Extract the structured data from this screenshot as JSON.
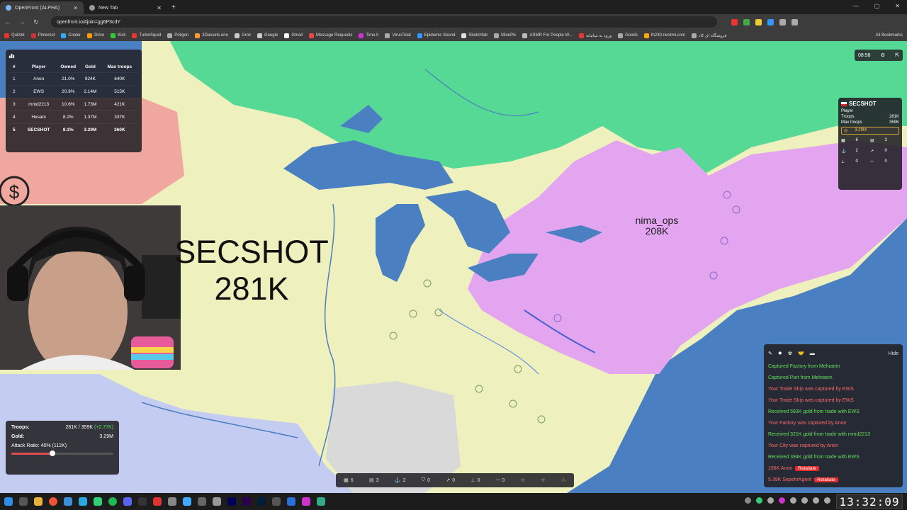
{
  "browser": {
    "tabs": [
      {
        "title": "OpenFront (ALPHA)",
        "active": true
      },
      {
        "title": "New Tab",
        "active": false
      }
    ],
    "url": "openfront.io/#join=gg6P3cdY",
    "bookmarks": [
      "Quizlet",
      "Pinterest",
      "Cooler",
      "Drive",
      "Kick",
      "TurboSquid",
      "Poligon",
      "3Dassets.one",
      "Grok",
      "Google",
      "Gmail",
      "Message Requests",
      "Time.lr",
      "VirusTotal",
      "Epidemic Sound",
      "Sketchfab",
      "MinePic",
      "ASMR For People W...",
      "ورود به سامانه",
      "Goods",
      "th230.nerdmi.com",
      "فروشگاه ای کاد"
    ],
    "all_bookmarks": "All Bookmarks"
  },
  "leaderboard": {
    "headers": [
      "#",
      "Player",
      "Owned",
      "Gold",
      "Max troops"
    ],
    "rows": [
      {
        "rank": "1",
        "player": "Anon",
        "owned": "21.0%",
        "gold": "924K",
        "max_troops": "640K"
      },
      {
        "rank": "2",
        "player": "EWS",
        "owned": "20.9%",
        "gold": "2.14M",
        "max_troops": "515K"
      },
      {
        "rank": "3",
        "player": "mmd2213",
        "owned": "10.6%",
        "gold": "1.73M",
        "max_troops": "421K"
      },
      {
        "rank": "4",
        "player": "Hesam",
        "owned": "8.2%",
        "gold": "1.37M",
        "max_troops": "337K"
      },
      {
        "rank": "5",
        "player": "SECSHOT",
        "owned": "8.1%",
        "gold": "3.29M",
        "max_troops": "360K"
      }
    ]
  },
  "game_clock": "08:58",
  "player_panel": {
    "name": "SECSHOT",
    "type": "Player",
    "troops_label": "Troops",
    "troops": "281K",
    "max_troops_label": "Max troops",
    "max_troops": "359K",
    "gold": "3.29M",
    "counts": [
      "6",
      "3",
      "2",
      "0",
      "0",
      "0"
    ]
  },
  "map_labels": {
    "self_name": "SECSHOT",
    "self_troops": "281K",
    "enemy_name": "nima_ops",
    "enemy_troops": "208K"
  },
  "status": {
    "troops_label": "Troops:",
    "troops_value": "281K / 359K",
    "troops_rate": "(+2.77K)",
    "gold_label": "Gold:",
    "gold_value": "3.29M",
    "attack_ratio": "Attack Ratio: 40% (112K)",
    "attack_ratio_fraction": 0.4
  },
  "build_bar": [
    "6",
    "3",
    "2",
    "0",
    "0",
    "0",
    "0"
  ],
  "event_log": {
    "hide_label": "Hide",
    "messages": [
      {
        "text": "Captured Factory from Mehraein",
        "color": "#62e05b"
      },
      {
        "text": "Captured Port from Mehraein",
        "color": "#62e05b"
      },
      {
        "text": "Your Trade Ship was captured by EWS",
        "color": "#ff6b6b"
      },
      {
        "text": "Your Trade Ship was captured by EWS",
        "color": "#ff6b6b"
      },
      {
        "text": "Received 593K gold from trade with EWS",
        "color": "#62e05b"
      },
      {
        "text": "Your Factory was captured by Anon",
        "color": "#ff6b6b"
      },
      {
        "text": "Received 321K gold from trade with mmd2213",
        "color": "#62e05b"
      },
      {
        "text": "Your City was captured by Anon",
        "color": "#ff6b6b"
      },
      {
        "text": "Received 394K gold from trade with EWS",
        "color": "#62e05b"
      }
    ],
    "attacks": [
      {
        "text": "156K Anon",
        "button": "Retaliate"
      },
      {
        "text": "5.39K SepehrAgent",
        "button": "Retaliate"
      }
    ]
  },
  "taskbar_time": "13:32:09",
  "colors": {
    "ocean": "#4a7fc1",
    "land": "#eef0bd",
    "green_territory": "#56d994",
    "purple_territory": "#e3a4f0",
    "blue_territory": "#c4ccf2",
    "red_territory": "#f0a7a0",
    "gray_territory": "#d9d9d9"
  }
}
